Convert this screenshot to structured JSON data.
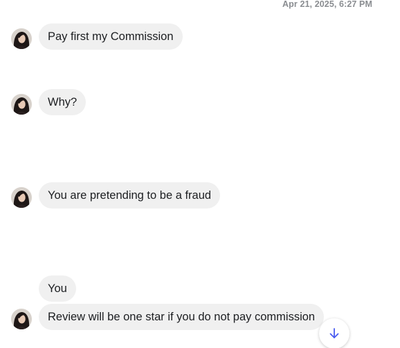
{
  "conversation": {
    "timestamp": "Apr 21, 2025, 6:27 PM",
    "messages": [
      {
        "text": "Pay first my Commission"
      },
      {
        "text": "Why?"
      },
      {
        "text": "You are pretending to be a fraud"
      },
      {
        "text": "You"
      },
      {
        "text": "Review will be one star if you do not pay commission"
      }
    ]
  },
  "icons": {
    "avatar": "contact-avatar",
    "scroll": "arrow-down-icon"
  },
  "colors": {
    "bubble": "#f0f0f0",
    "text": "#1c1e21",
    "timestamp": "#8a8d91",
    "accent": "#4a5cf0"
  }
}
